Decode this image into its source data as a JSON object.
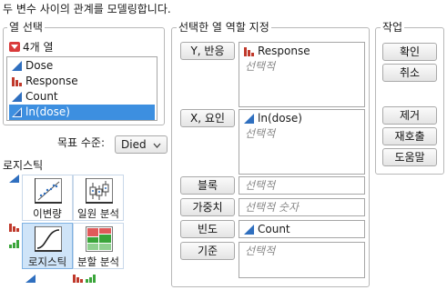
{
  "header": {
    "description": "두 변수 사이의 관계를 모델링합니다."
  },
  "column_select": {
    "title": "열 선택",
    "count_label": "4개 열",
    "columns": [
      {
        "name": "Dose",
        "type": "continuous"
      },
      {
        "name": "Response",
        "type": "nominal"
      },
      {
        "name": "Count",
        "type": "continuous"
      },
      {
        "name": "ln(dose)",
        "type": "continuous",
        "selected": true
      }
    ]
  },
  "target": {
    "label": "목표 수준:",
    "value": "Died"
  },
  "logistic": {
    "title": "로지스틱",
    "tiles": [
      {
        "label": "이변량"
      },
      {
        "label": "일원 분석"
      },
      {
        "label": "로지스틱",
        "selected": true
      },
      {
        "label": "분할 분석"
      }
    ]
  },
  "roles": {
    "title": "선택한 열 역할 지정",
    "y": {
      "button": "Y, 반응",
      "value": "Response",
      "placeholder": "선택적"
    },
    "x": {
      "button": "X, 요인",
      "value": "ln(dose)",
      "placeholder": "선택적"
    },
    "block": {
      "button": "블록",
      "placeholder": "선택적"
    },
    "weight": {
      "button": "가중치",
      "placeholder": "선택적 숫자"
    },
    "freq": {
      "button": "빈도",
      "value": "Count"
    },
    "by": {
      "button": "기준",
      "placeholder": "선택적"
    }
  },
  "actions": {
    "title": "작업",
    "ok": "확인",
    "cancel": "취소",
    "remove": "제거",
    "recall": "재호출",
    "help": "도움말"
  },
  "colors": {
    "selection": "#3d8fe0",
    "nominal_icon": "#c0392b",
    "continuous_icon": "#2f6fbf",
    "ordinal_icon": "#3aa53a"
  }
}
